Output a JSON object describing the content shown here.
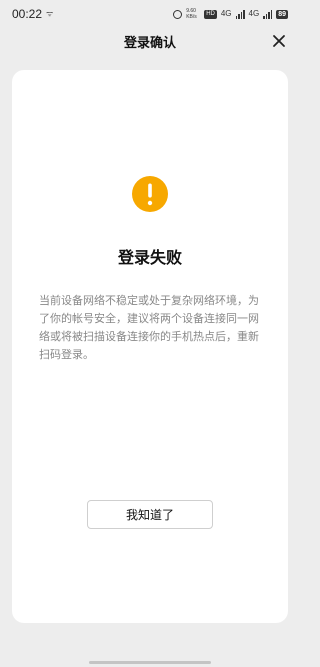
{
  "status_bar": {
    "time": "00:22",
    "network_speed": "9.60 KB/s",
    "hd_badge": "HD",
    "signal1": "4G",
    "signal2": "4G",
    "battery": "89"
  },
  "header": {
    "title": "登录确认",
    "close_icon": "close-icon"
  },
  "card": {
    "icon": "warning-icon",
    "accent_color": "#f7a800",
    "title": "登录失败",
    "message": "当前设备网络不稳定或处于复杂网络环境，为了你的帐号安全，建议将两个设备连接同一网络或将被扫描设备连接你的手机热点后，重新扫码登录。",
    "button_label": "我知道了"
  }
}
